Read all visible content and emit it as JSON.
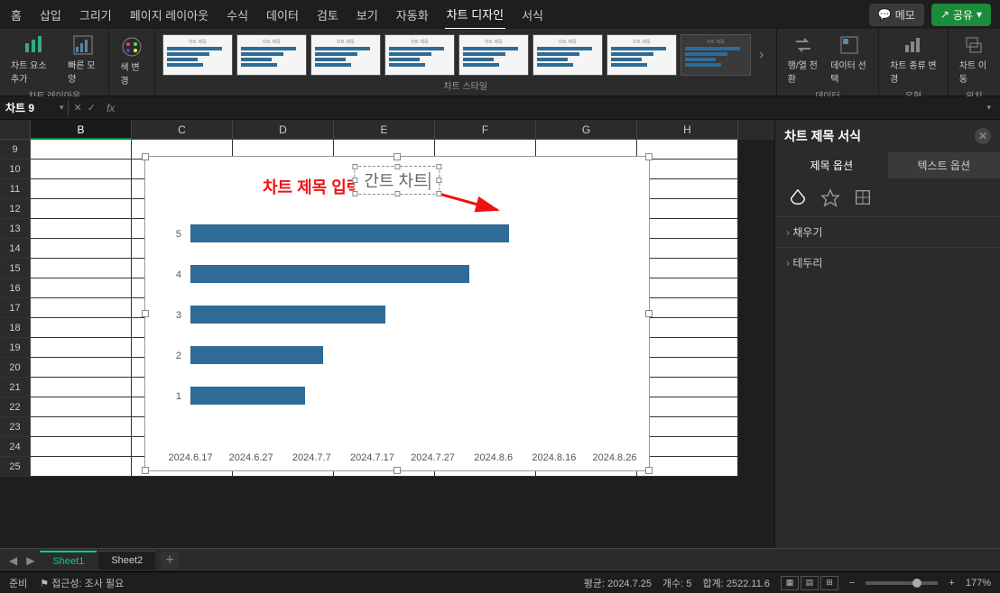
{
  "ribbon": {
    "tabs": [
      "홈",
      "삽입",
      "그리기",
      "페이지 레이아웃",
      "수식",
      "데이터",
      "검토",
      "보기",
      "자동화",
      "차트 디자인",
      "서식"
    ],
    "active_tab": "차트 디자인",
    "comment_btn": "메모",
    "share_btn": "공유",
    "groups": {
      "layout": {
        "btn1": "차트 요소 추가",
        "btn2": "빠른 모양",
        "label": "차트 레이아웃"
      },
      "color": {
        "btn": "색 변경"
      },
      "styles": {
        "label": "차트 스타일",
        "thumb_title": "차트 제목"
      },
      "data": {
        "btn1": "행/열 전환",
        "btn2": "데이터 선택",
        "label": "데이터"
      },
      "type": {
        "btn": "차트 종류 변경",
        "label": "유형"
      },
      "location": {
        "btn": "차트 이동",
        "label": "위치"
      }
    }
  },
  "namebox": {
    "value": "차트 9"
  },
  "columns": [
    "B",
    "C",
    "D",
    "E",
    "F",
    "G",
    "H"
  ],
  "start_row": 9,
  "row_count": 17,
  "annotation": "차트 제목 입력",
  "chart_title": "간트 차트",
  "chart_data": {
    "type": "bar",
    "title": "간트 차트",
    "y_categories": [
      "5",
      "4",
      "3",
      "2",
      "1"
    ],
    "x_ticks": [
      "2024.6.17",
      "2024.6.27",
      "2024.7.7",
      "2024.7.17",
      "2024.7.27",
      "2024.8.6",
      "2024.8.16",
      "2024.8.26"
    ],
    "bar_fractions": [
      0.72,
      0.63,
      0.44,
      0.3,
      0.26
    ],
    "xlabel": "",
    "ylabel": ""
  },
  "format_pane": {
    "title": "차트 제목 서식",
    "tab1": "제목 옵션",
    "tab2": "텍스트 옵션",
    "section1": "채우기",
    "section2": "테두리"
  },
  "sheets": {
    "active": "Sheet1",
    "list": [
      "Sheet1",
      "Sheet2"
    ]
  },
  "status": {
    "ready": "준비",
    "access": "접근성: 조사 필요",
    "avg_label": "평균:",
    "avg": "2024.7.25",
    "count_label": "개수:",
    "count": "5",
    "sum_label": "합계:",
    "sum": "2522.11.6",
    "zoom": "177%"
  }
}
